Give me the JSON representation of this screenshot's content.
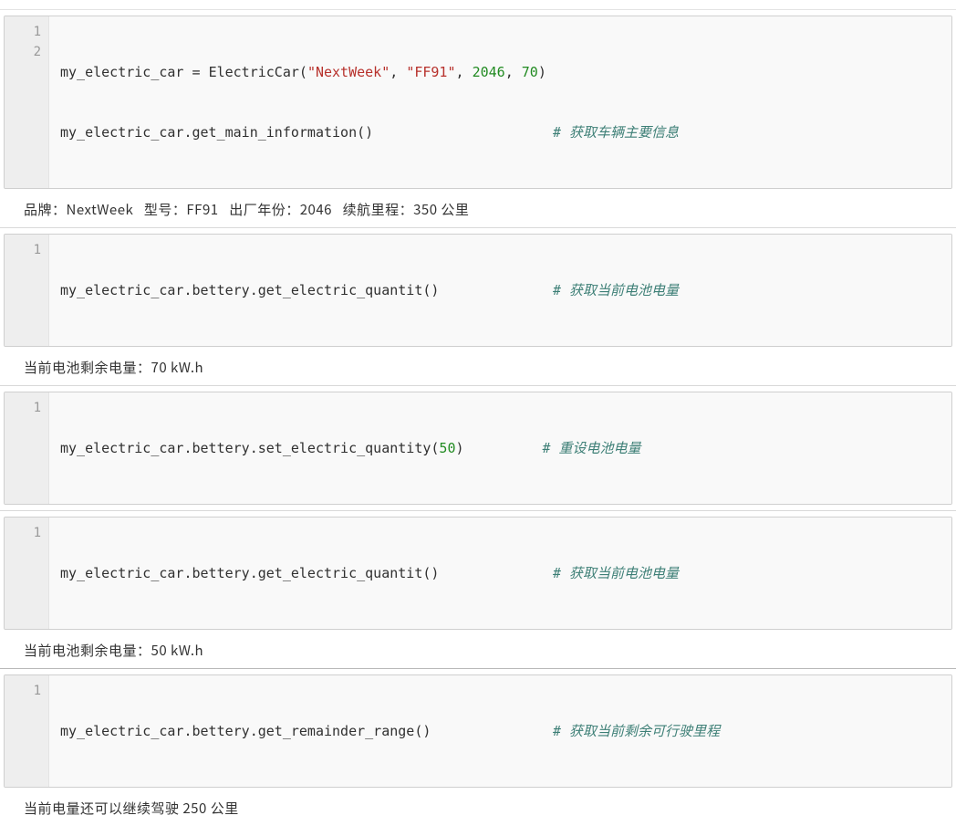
{
  "cell1": {
    "gutter": [
      "1",
      "2"
    ],
    "line1": {
      "lhs": "my_electric_car",
      "assign": " = ",
      "cls": "ElectricCar",
      "paren_open": "(",
      "arg1": "\"NextWeek\"",
      "comma1": ", ",
      "arg2": "\"FF91\"",
      "comma2": ", ",
      "arg3": "2046",
      "comma3": ", ",
      "arg4": "70",
      "paren_close": ")"
    },
    "line2": {
      "code": "my_electric_car.get_main_information()",
      "comment": "# 获取车辆主要信息"
    }
  },
  "out1": "品牌：NextWeek   型号：FF91   出厂年份：2046   续航里程：350 公里",
  "cell2": {
    "gutter": [
      "1"
    ],
    "line1": {
      "code": "my_electric_car.bettery.get_electric_quantit()",
      "comment": "# 获取当前电池电量"
    }
  },
  "out2": "当前电池剩余电量：70 kW.h",
  "cell3": {
    "gutter": [
      "1"
    ],
    "line1": {
      "code_pre": "my_electric_car.bettery.set_electric_quantity(",
      "num": "50",
      "code_post": ")",
      "comment": "# 重设电池电量"
    }
  },
  "cell4": {
    "gutter": [
      "1"
    ],
    "line1": {
      "code": "my_electric_car.bettery.get_electric_quantit()",
      "comment": "# 获取当前电池电量"
    }
  },
  "out4": "当前电池剩余电量：50 kW.h",
  "cell5": {
    "gutter": [
      "1"
    ],
    "line1": {
      "code": "my_electric_car.bettery.get_remainder_range()",
      "comment": "# 获取当前剩余可行驶里程"
    }
  },
  "out5": "当前电量还可以继续驾驶 250 公里"
}
